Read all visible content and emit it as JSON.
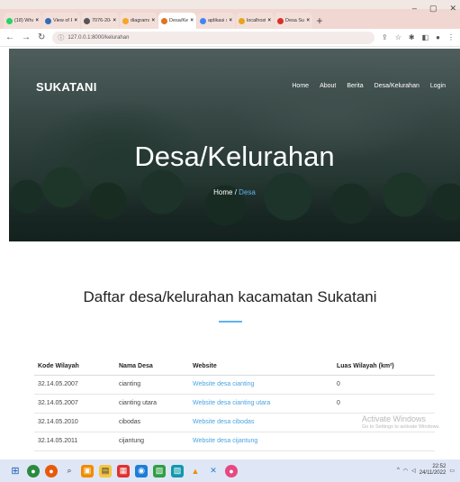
{
  "browser": {
    "tabs": [
      {
        "label": "(18) Whats",
        "icon_color": "#25d366",
        "active": false
      },
      {
        "label": "View of Pe",
        "icon_color": "#2f6db5",
        "active": false
      },
      {
        "label": "7076-2041",
        "icon_color": "#555555",
        "active": false
      },
      {
        "label": "diagrams",
        "icon_color": "#f5a623",
        "active": false
      },
      {
        "label": "Desa/Kelu",
        "icon_color": "#e0731f",
        "active": true
      },
      {
        "label": "aplikasi sis",
        "icon_color": "#4285f4",
        "active": false
      },
      {
        "label": "localhost",
        "icon_color": "#e8a317",
        "active": false
      },
      {
        "label": "Desa Suka",
        "icon_color": "#d93025",
        "active": false
      }
    ],
    "new_tab": "+",
    "window_controls": {
      "minimize": "–",
      "maximize": "▢",
      "close": "✕"
    },
    "url": "127.0.0.1:8000/kelurahan"
  },
  "site": {
    "brand": "SUKATANI",
    "nav": [
      "Home",
      "About",
      "Berita",
      "Desa/Kelurahan",
      "Login"
    ],
    "hero_title": "Desa/Kelurahan",
    "breadcrumb": {
      "home": "Home",
      "separator": "/",
      "current": "Desa"
    }
  },
  "content": {
    "section_title": "Daftar desa/kelurahan kacamatan Sukatani",
    "table": {
      "headers": [
        "Kode Wilayah",
        "Nama Desa",
        "Website",
        "Luas Wilayah (km²)"
      ],
      "rows": [
        [
          "32.14.05.2007",
          "cianting",
          "Website desa cianting",
          "0"
        ],
        [
          "32.14.05.2007",
          "cianting utara",
          "Website desa cianting utara",
          "0"
        ],
        [
          "32.14.05.2010",
          "cibodas",
          "Website desa cibodas",
          ""
        ],
        [
          "32.14.05.2011",
          "cijantung",
          "Website desa cijantung",
          ""
        ]
      ]
    }
  },
  "watermark": {
    "line1": "Activate Windows",
    "line2": "Go to Settings to activate Windows."
  },
  "taskbar": {
    "time": "22:52",
    "date": "24/11/2022",
    "accent": "#dfe6f5"
  },
  "colors": {
    "link": "#4aa3e0",
    "accent": "#5fb3f0"
  }
}
